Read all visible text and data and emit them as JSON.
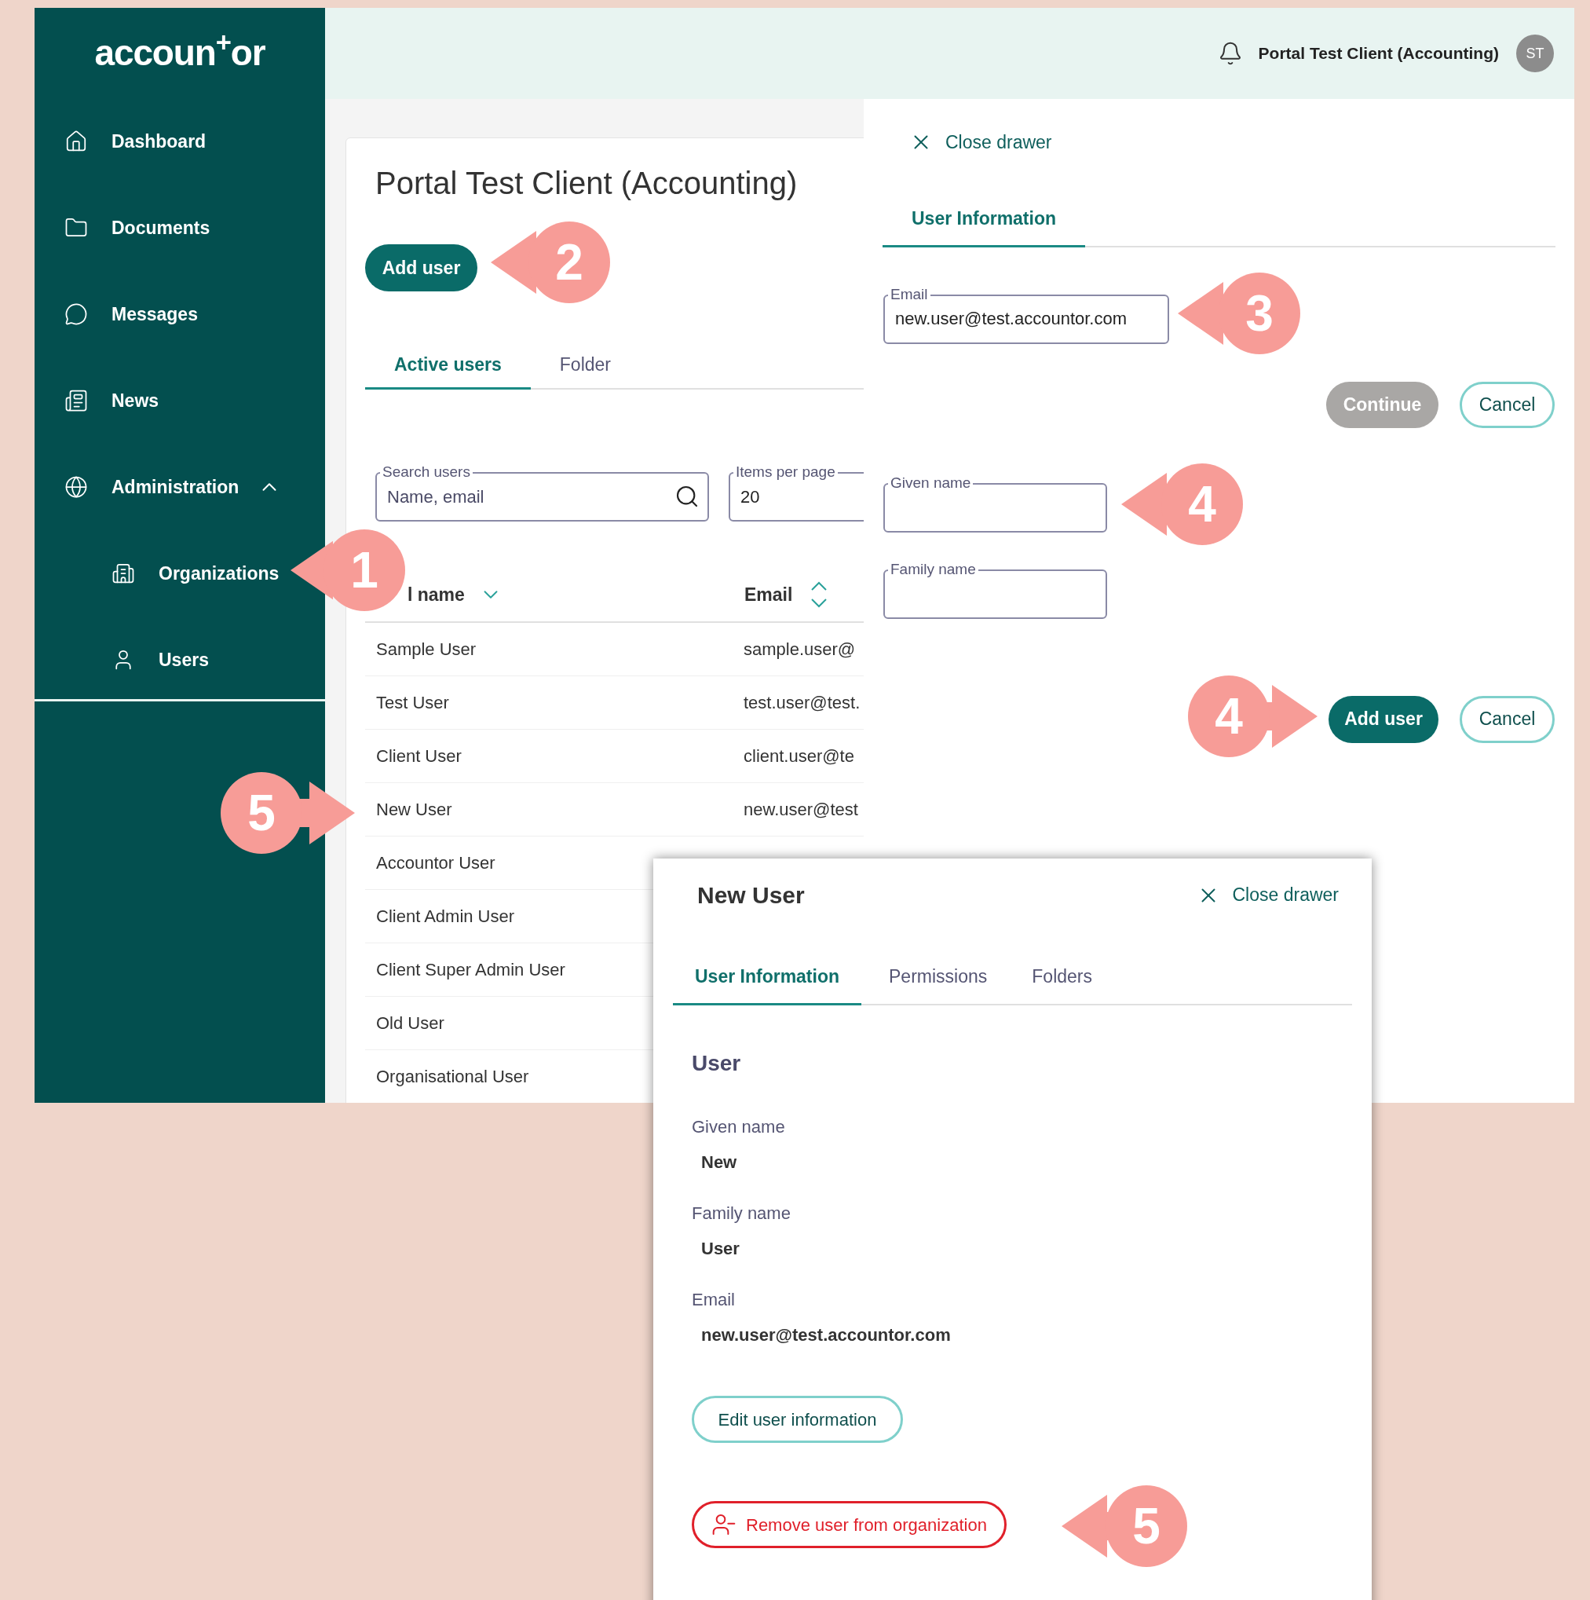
{
  "logo": "accoun$^{+}$or",
  "sidebar": {
    "items": [
      {
        "label": "Dashboard"
      },
      {
        "label": "Documents"
      },
      {
        "label": "Messages"
      },
      {
        "label": "News"
      },
      {
        "label": "Administration",
        "expanded": true,
        "children": [
          {
            "label": "Organizations"
          },
          {
            "label": "Users"
          }
        ]
      }
    ]
  },
  "header": {
    "client": "Portal Test Client (Accounting)",
    "avatar": "ST"
  },
  "page": {
    "title": "Portal Test Client (Accounting)",
    "add_button": "Add user",
    "tabs": [
      {
        "label": "Active users",
        "selected": true
      },
      {
        "label": "Folder",
        "selected": false
      }
    ],
    "search": {
      "label": "Search users",
      "placeholder": "Name, email"
    },
    "items_per_page": {
      "label": "Items per page",
      "value": "20"
    },
    "table": {
      "columns": [
        {
          "label": "l name",
          "sorted": true
        },
        {
          "label": "Email",
          "sorted": false
        }
      ],
      "rows": [
        {
          "name": "Sample User",
          "email": "sample.user@"
        },
        {
          "name": "Test User",
          "email": "test.user@test."
        },
        {
          "name": "Client User",
          "email": "client.user@te"
        },
        {
          "name": "New User",
          "email": "new.user@test"
        },
        {
          "name": "Accountor User"
        },
        {
          "name": "Client Admin User"
        },
        {
          "name": "Client Super Admin User"
        },
        {
          "name": "Old User"
        },
        {
          "name": "Organisational User"
        }
      ]
    }
  },
  "drawer": {
    "close": "Close drawer",
    "tabs": [
      {
        "label": "User Information",
        "selected": true
      }
    ],
    "email": {
      "label": "Email",
      "value": "new.user@test.accountor.com"
    },
    "continue": {
      "label": "Continue",
      "disabled": true
    },
    "cancel": "Cancel",
    "given_name": {
      "label": "Given name"
    },
    "family_name": {
      "label": "Family name"
    },
    "submit": "Add user",
    "cancel_2": "Cancel"
  },
  "user_drawer": {
    "title": "New User",
    "close": "Close drawer",
    "tabs": [
      {
        "label": "User Information",
        "selected": true
      },
      {
        "label": "Permissions",
        "selected": false
      },
      {
        "label": "Folders",
        "selected": false
      }
    ],
    "section": "User",
    "fields": [
      {
        "label": "Given name",
        "value": "New"
      },
      {
        "label": "Family name",
        "value": "User"
      },
      {
        "label": "Email",
        "value": "new.user@test.accountor.com"
      }
    ],
    "edit_button": "Edit user information",
    "remove_button": "Remove user from organization"
  },
  "annotations": [
    {
      "label": "1",
      "kind": "left"
    },
    {
      "label": "2",
      "kind": "left"
    },
    {
      "label": "3",
      "kind": "left"
    },
    {
      "label": "4",
      "kind": "left"
    },
    {
      "label": "4",
      "kind": "right"
    },
    {
      "label": "5",
      "kind": "right"
    },
    {
      "label": "5",
      "kind": "left"
    }
  ]
}
